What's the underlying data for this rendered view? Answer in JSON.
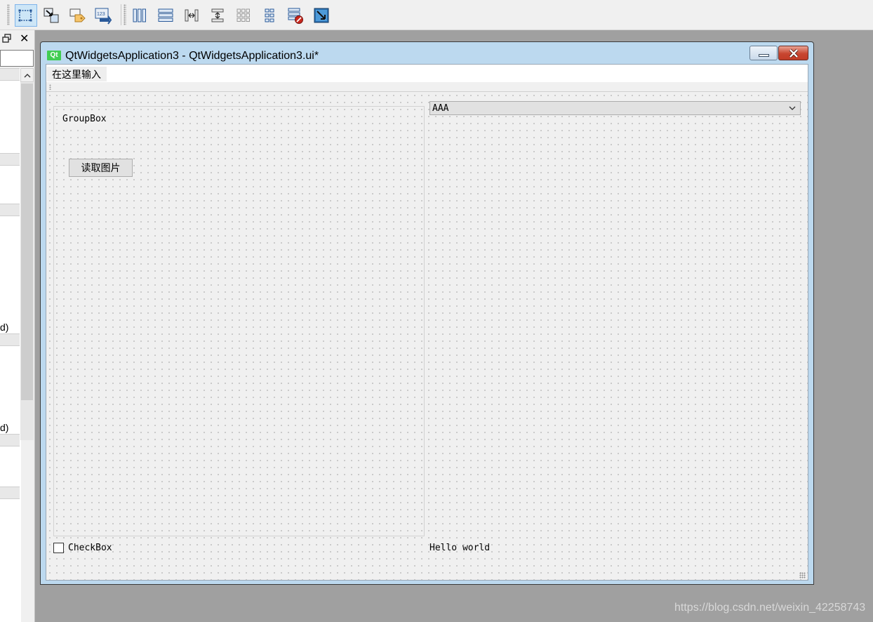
{
  "toolbar": {
    "buttons": [
      {
        "icon": "edit-widgets-icon",
        "active": true
      },
      {
        "icon": "edit-signals-slots-icon"
      },
      {
        "icon": "edit-buddies-icon"
      },
      {
        "icon": "edit-tab-order-icon",
        "text": "123"
      },
      {
        "icon": "lay-out-horizontally-icon"
      },
      {
        "icon": "lay-out-vertically-icon"
      },
      {
        "icon": "horizontal-splitter-icon"
      },
      {
        "icon": "vertical-splitter-icon"
      },
      {
        "icon": "form-layout-icon"
      },
      {
        "icon": "grid-layout-icon"
      },
      {
        "icon": "break-layout-icon"
      },
      {
        "icon": "adjust-size-icon"
      }
    ]
  },
  "dock": {
    "float_icon": "float-icon",
    "close_glyph": "✕",
    "fragments": [
      "d)",
      "d)"
    ]
  },
  "form_window": {
    "app_icon_text": "Qt",
    "title": "QtWidgetsApplication3 - QtWidgetsApplication3.ui*",
    "menu_placeholder": "在这里输入",
    "groupbox_title": "GroupBox",
    "push_button_label": "读取图片",
    "combo_value": "AAA",
    "checkbox_label": "CheckBox",
    "checkbox_checked": false,
    "label_text": "Hello world"
  },
  "colors": {
    "accent": "#41cd52",
    "close_button": "#c84630",
    "title_bar": "#bcd9ef",
    "workspace": "#a0a0a0"
  },
  "watermark": "https://blog.csdn.net/weixin_42258743"
}
